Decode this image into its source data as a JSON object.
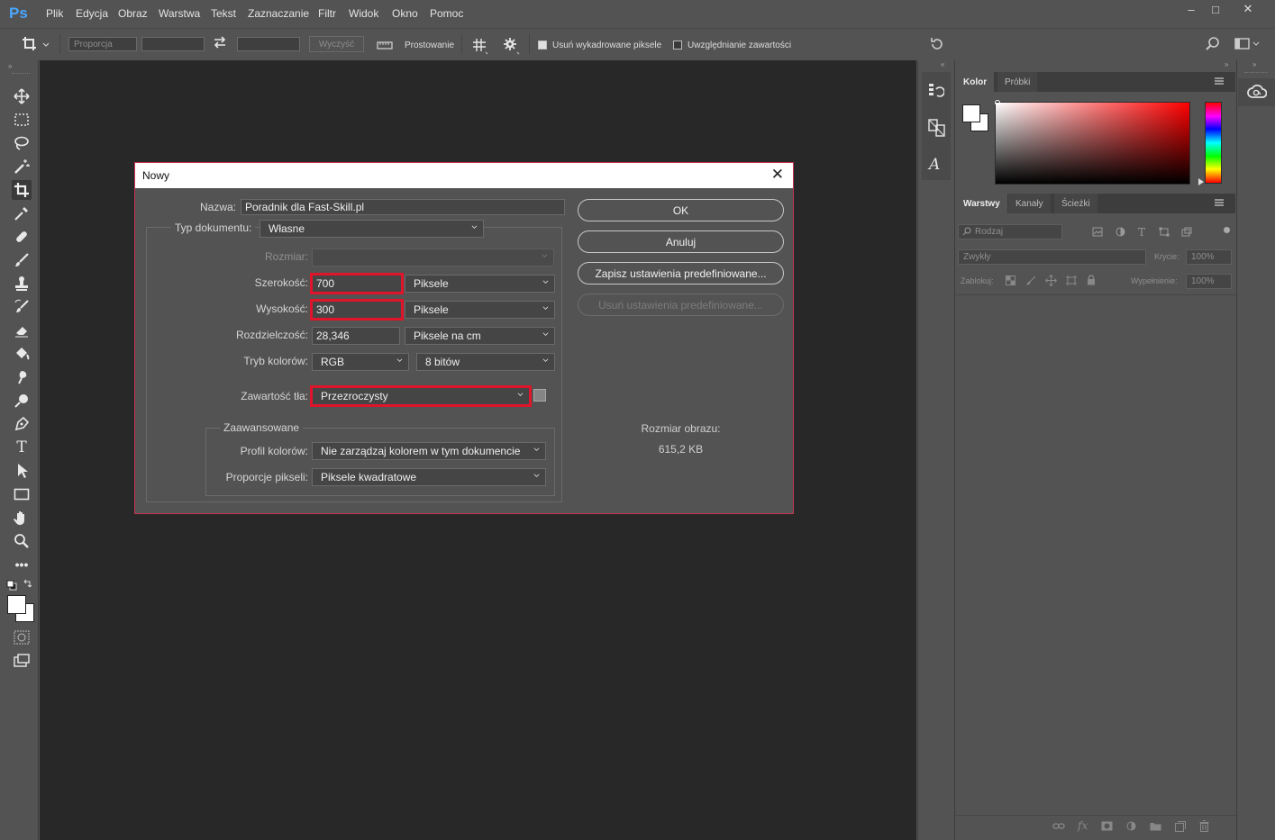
{
  "app": {
    "logo": "Ps",
    "menu": [
      "Plik",
      "Edycja",
      "Obraz",
      "Warstwa",
      "Tekst",
      "Zaznaczanie",
      "Filtr",
      "Widok",
      "Okno",
      "Pomoc"
    ],
    "window_controls": [
      "–",
      "□",
      "✕"
    ]
  },
  "options_bar": {
    "ratio_select": "Proporcja",
    "clear_button": "Wyczyść",
    "straighten_label": "Prostowanie",
    "delete_cropped_label": "Usuń wykadrowane piksele",
    "delete_cropped_checked": true,
    "content_aware_label": "Uwzględnianie zawartości",
    "content_aware_checked": false
  },
  "color_panel": {
    "tabs": [
      "Kolor",
      "Próbki"
    ],
    "active_tab": "Kolor",
    "hue_color": "#ff0000"
  },
  "layers_panel": {
    "tabs": [
      "Warstwy",
      "Kanały",
      "Ścieżki"
    ],
    "active_tab": "Warstwy",
    "filter_placeholder": "Rodzaj",
    "blend_mode": "Zwykły",
    "opacity_label": "Krycie:",
    "opacity_value": "100%",
    "lock_label": "Zablokuj:",
    "fill_label": "Wypełnienie:",
    "fill_value": "100%"
  },
  "dialog": {
    "title": "Nowy",
    "close_glyph": "✕",
    "name_label": "Nazwa:",
    "name_value": "Poradnik dla Fast-Skill.pl",
    "doc_type_label": "Typ dokumentu:",
    "doc_type_value": "Własne",
    "size_label": "Rozmiar:",
    "size_value": "",
    "width_label": "Szerokość:",
    "width_value": "700",
    "width_unit": "Piksele",
    "height_label": "Wysokość:",
    "height_value": "300",
    "height_unit": "Piksele",
    "resolution_label": "Rozdzielczość:",
    "resolution_value": "28,346",
    "resolution_unit": "Piksele na cm",
    "color_mode_label": "Tryb kolorów:",
    "color_mode_value": "RGB",
    "bit_depth_value": "8 bitów",
    "background_label": "Zawartość tła:",
    "background_value": "Przezroczysty",
    "advanced_legend": "Zaawansowane",
    "color_profile_label": "Profil kolorów:",
    "color_profile_value": "Nie zarządzaj kolorem w tym dokumencie",
    "pixel_aspect_label": "Proporcje pikseli:",
    "pixel_aspect_value": "Piksele kwadratowe",
    "buttons": {
      "ok": "OK",
      "cancel": "Anuluj",
      "save_preset": "Zapisz ustawienia predefiniowane...",
      "delete_preset": "Usuń ustawienia predefiniowane..."
    },
    "image_size_label": "Rozmiar obrazu:",
    "image_size_value": "615,2 KB",
    "highlight_color": "#e0142a"
  }
}
